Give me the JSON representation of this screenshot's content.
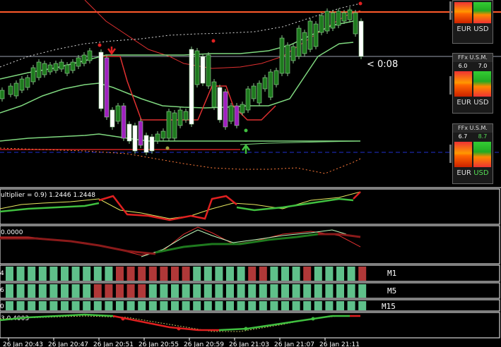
{
  "countdown": "< 0:08",
  "indicator1": {
    "text": "ultiplier = 0.9) 1.2446 1.2448"
  },
  "indicator2": {
    "text": "0.0000"
  },
  "mtf_rows": [
    {
      "left": "4",
      "label": "M1"
    },
    {
      "left": "6",
      "label": "M5"
    },
    {
      "left": "0",
      "label": "M15"
    }
  ],
  "indicator4": {
    "text": "3 0.4003"
  },
  "time_axis": [
    "26 Jan 20:43",
    "26 Jan 20:47",
    "26 Jan 20:51",
    "26 Jan 20:55",
    "26 Jan 20:59",
    "26 Jan 21:03",
    "26 Jan 21:07",
    "26 Jan 21:11"
  ],
  "panels": [
    {
      "header": "",
      "v1": "",
      "v2": "",
      "base": "EUR",
      "quote": "USD"
    },
    {
      "header": "FFx U.S.M.",
      "v1": "6.0",
      "v2": "7.0",
      "base": "EUR",
      "quote": "USD"
    },
    {
      "header": "FFx U.S.M.",
      "v1": "6.7",
      "v2": "8.7",
      "base": "EUR",
      "quote": "USD"
    }
  ],
  "colors": {
    "bull_candle": "#1e7a1e",
    "bear_candle": "#ffffff",
    "band_green": "#7fd87f",
    "band_red": "#e03030",
    "mtf_bull": "#5fc08a",
    "mtf_bear": "#b03838"
  }
}
